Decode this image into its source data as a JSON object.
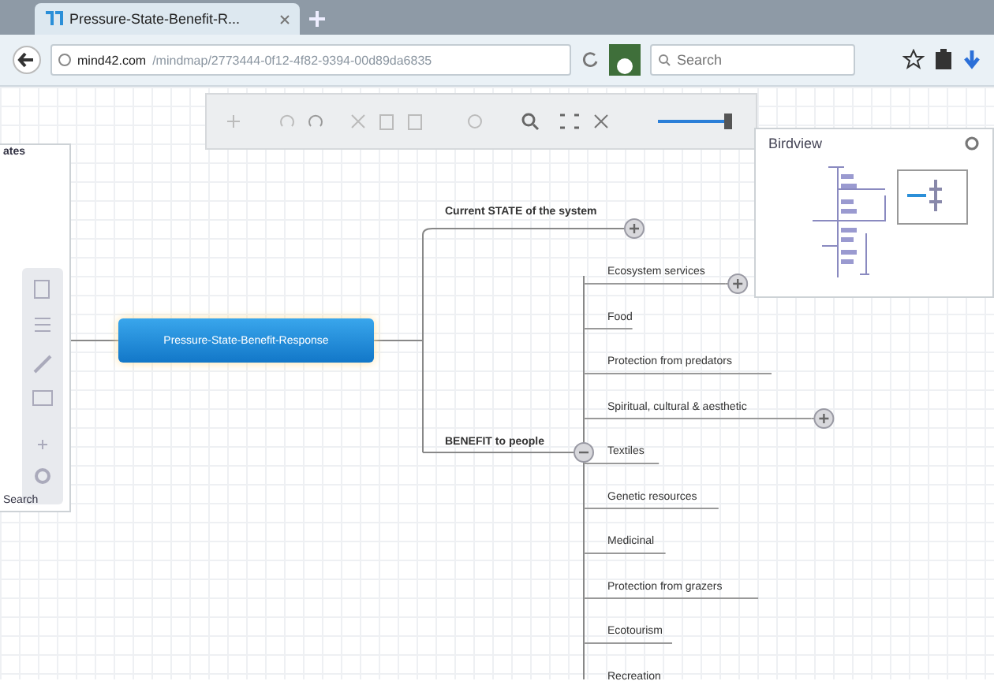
{
  "browser": {
    "tab": {
      "title": "Pressure-State-Benefit-R..."
    },
    "url": {
      "domain": "mind42.com",
      "path": "/mindmap/2773444-0f12-4f82-9394-00d89da6835"
    },
    "search": {
      "placeholder": "Search"
    }
  },
  "side_panel": {
    "top_label": "ates",
    "bottom_label": "Search"
  },
  "birdview": {
    "title": "Birdview"
  },
  "mindmap": {
    "root": "Pressure-State-Benefit-Response",
    "branches": [
      {
        "label": "Current STATE of the system",
        "collapsed": true
      },
      {
        "label": "BENEFIT to people",
        "collapsed": false,
        "children": [
          {
            "label": "Ecosystem services",
            "collapsed": true
          },
          {
            "label": "Food",
            "collapsed": false
          },
          {
            "label": "Protection from predators",
            "collapsed": false
          },
          {
            "label": "Spiritual, cultural & aesthetic",
            "collapsed": true
          },
          {
            "label": "Textiles",
            "collapsed": false
          },
          {
            "label": "Genetic resources",
            "collapsed": false
          },
          {
            "label": "Medicinal",
            "collapsed": false
          },
          {
            "label": "Protection from grazers",
            "collapsed": false
          },
          {
            "label": "Ecotourism",
            "collapsed": false
          },
          {
            "label": "Recreation",
            "collapsed": false
          }
        ]
      }
    ]
  }
}
